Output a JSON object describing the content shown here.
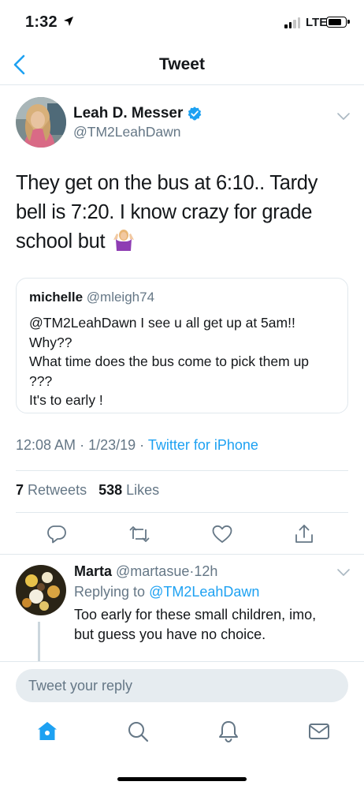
{
  "status_bar": {
    "time": "1:32",
    "network": "LTE"
  },
  "nav": {
    "title": "Tweet"
  },
  "tweet": {
    "author_name": "Leah D. Messer",
    "author_handle": "@TM2LeahDawn",
    "text": "They get on the bus at 6:10.. Tardy bell is 7:20. I know crazy for grade school but",
    "quoted": {
      "author_name": "michelle",
      "author_handle": "@mleigh74",
      "text_lines": [
        "@TM2LeahDawn I see u all get up at 5am!!",
        "Why??",
        "What time does the bus come to pick them up",
        "???",
        "It's to early !"
      ]
    },
    "time": "12:08 AM",
    "date": "1/23/19",
    "separator": "·",
    "source": "Twitter for iPhone",
    "retweets_count": "7",
    "retweets_label": "Retweets",
    "likes_count": "538",
    "likes_label": "Likes"
  },
  "reply": {
    "author_name": "Marta",
    "author_handle": "@martasue",
    "age": "12h",
    "replying_prefix": "Replying to",
    "replying_to": "@TM2LeahDawn",
    "text_lines": [
      "Too early for these small children, imo,",
      "but guess you have no choice."
    ]
  },
  "compose": {
    "placeholder": "Tweet your reply"
  },
  "tabs": [
    "home-icon",
    "search-icon",
    "notifications-icon",
    "messages-icon"
  ],
  "colors": {
    "accent": "#1DA1F2",
    "secondary_text": "#657786",
    "divider": "#E1E8ED"
  }
}
